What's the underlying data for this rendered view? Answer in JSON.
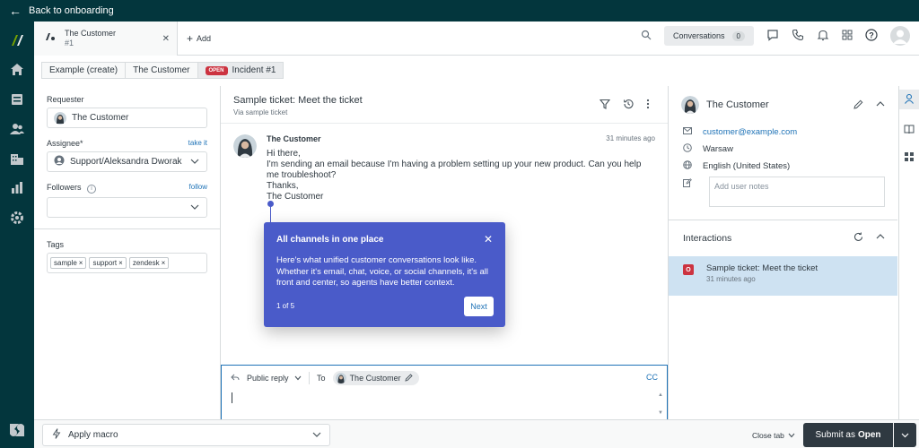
{
  "topbar": {
    "back_label": "Back to onboarding"
  },
  "tabs": {
    "ticket_name": "The Customer",
    "ticket_number": "#1",
    "add_label": "Add"
  },
  "header": {
    "conversations_label": "Conversations",
    "conversations_count": "0"
  },
  "breadcrumbs": {
    "org": "Example (create)",
    "customer": "The Customer",
    "status_badge": "OPEN",
    "incident": "Incident #1"
  },
  "properties": {
    "requester_label": "Requester",
    "requester_value": "The Customer",
    "assignee_label": "Assignee*",
    "assignee_link": "take it",
    "assignee_value": "Support/Aleksandra Dworak",
    "followers_label": "Followers",
    "followers_link": "follow",
    "tags_label": "Tags",
    "tags": [
      "sample",
      "support",
      "zendesk"
    ]
  },
  "conversation": {
    "title": "Sample ticket: Meet the ticket",
    "subtitle": "Via sample ticket",
    "message": {
      "author": "The Customer",
      "time": "31 minutes ago",
      "lines": [
        "Hi there,",
        "I'm sending an email because I'm having a problem setting up your new product. Can you help me troubleshoot?",
        "Thanks,",
        "The Customer"
      ]
    }
  },
  "popover": {
    "title": "All channels in one place",
    "text": "Here's what unified customer conversations look like. Whether it's email, chat, voice, or social channels, it's all front and center, so agents have better context.",
    "step": "1 of 5",
    "next_label": "Next"
  },
  "reply": {
    "mode_label": "Public reply",
    "to_label": "To",
    "recipient": "The Customer",
    "cc_label": "CC"
  },
  "customer": {
    "name": "The Customer",
    "email": "customer@example.com",
    "city": "Warsaw",
    "locale": "English (United States)",
    "notes_placeholder": "Add user notes"
  },
  "interactions": {
    "title": "Interactions",
    "item_title": "Sample ticket: Meet the ticket",
    "item_time": "31 minutes ago",
    "item_icon_letter": "O"
  },
  "bottombar": {
    "macro_label": "Apply macro",
    "close_tab_label": "Close tab",
    "submit_prefix": "Submit as",
    "submit_status": "Open"
  },
  "colors": {
    "brand_dark": "#03363d",
    "popover": "#4a5bc9",
    "link": "#1f73b7",
    "open_red": "#cc3340",
    "selected_row": "#cee2f2"
  }
}
